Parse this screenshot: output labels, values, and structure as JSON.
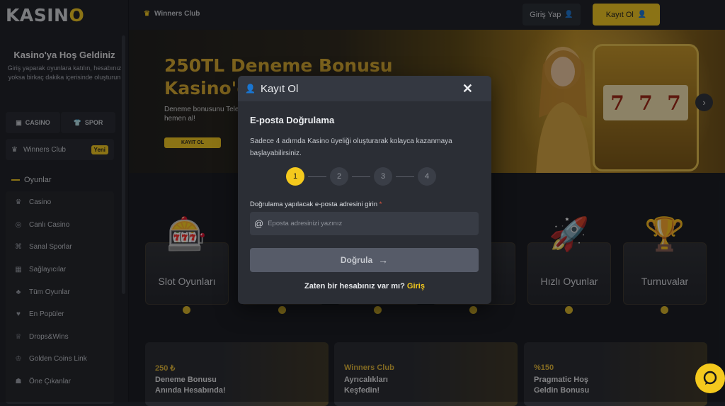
{
  "brand": {
    "logo_pre": "KASIN",
    "logo_o": "O",
    "accent": "#f4c91d"
  },
  "sidebar": {
    "welcome_title": "Kasino'ya Hoş Geldiniz",
    "welcome_desc": "Giriş yaparak oyunlara katılın, hesabınız yoksa birkaç dakika içerisinde oluşturun",
    "casino_tab": "CASINO",
    "spor_tab": "SPOR",
    "winners_club": "Winners Club",
    "winners_badge": "Yeni",
    "games_heading": "Oyunlar",
    "items": [
      {
        "label": "Casino",
        "icon": "casino-icon",
        "glyph": "♛"
      },
      {
        "label": "Canlı Casino",
        "icon": "live-casino-icon",
        "glyph": "◎"
      },
      {
        "label": "Sanal Sporlar",
        "icon": "gamepad-icon",
        "glyph": "⌘"
      },
      {
        "label": "Sağlayıcılar",
        "icon": "providers-icon",
        "glyph": "▦"
      },
      {
        "label": "Tüm Oyunlar",
        "icon": "all-games-icon",
        "glyph": "♣"
      },
      {
        "label": "En Popüler",
        "icon": "popular-icon",
        "glyph": "♥"
      },
      {
        "label": "Drops&Wins",
        "icon": "trophy-icon",
        "glyph": "♕"
      },
      {
        "label": "Golden Coins Link",
        "icon": "coins-icon",
        "glyph": "♔"
      },
      {
        "label": "Öne Çıkanlar",
        "icon": "featured-icon",
        "glyph": "☗"
      }
    ]
  },
  "topbar": {
    "winners_club": "Winners Club",
    "login_label": "Giriş Yap",
    "register_label": "Kayıt Ol"
  },
  "banner": {
    "title_line1": "250TL Deneme Bonusu",
    "title_line2": "Kasino'da",
    "desc": "Deneme bonusunu Tele hemen al!",
    "button": "KAYIT OL"
  },
  "categories": [
    {
      "label": "Slot Oyunları",
      "icon": "slot-machine-icon"
    },
    {
      "label": "Hızlı Oyunlar",
      "icon": "rocket-icon"
    },
    {
      "label": "Turnuvalar",
      "icon": "trophy-icon"
    }
  ],
  "promos": [
    {
      "a": "250 ₺",
      "b": "Deneme Bonusu Anında Hesabında!"
    },
    {
      "a": "Winners Club",
      "b": "Ayrıcalıkları Keşfedin!"
    },
    {
      "a": "%150",
      "b": "Pragmatic Hoş Geldin Bonusu"
    }
  ],
  "modal": {
    "title": "Kayıt Ol",
    "subtitle": "E-posta Doğrulama",
    "description": "Sadece 4 adımda Kasino üyeliği oluşturarak kolayca kazanmaya başlayabilirsiniz.",
    "steps": [
      "1",
      "2",
      "3",
      "4"
    ],
    "active_step": 1,
    "email_label": "Doğrulama yapılacak e-posta adresini girin",
    "required_mark": "*",
    "email_placeholder": "Eposta adresinizi yazınız",
    "email_value": "",
    "verify_button": "Doğrula",
    "login_prompt": "Zaten bir hesabınız var mı?",
    "login_link": "Giriş"
  }
}
